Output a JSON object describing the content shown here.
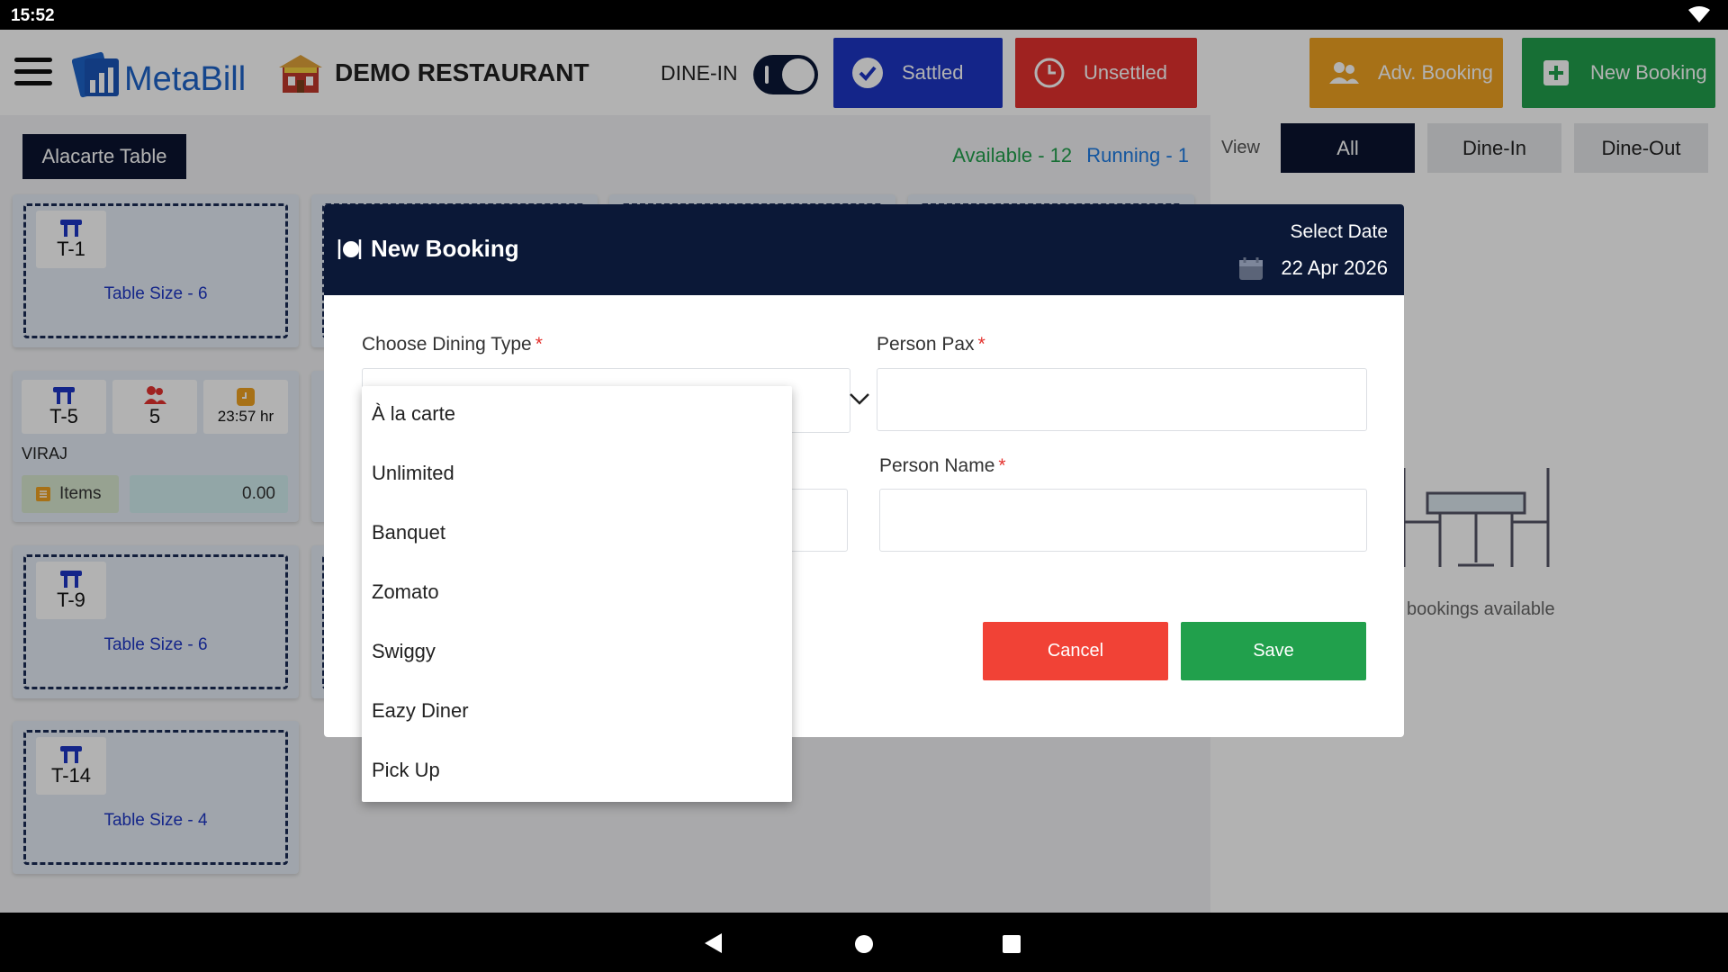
{
  "status_bar": {
    "time": "15:52",
    "wifi_icon": "wifi-icon"
  },
  "header": {
    "menu_icon": "hamburger-menu-icon",
    "app_name": "MetaBill",
    "restaurant_name": "DEMO RESTAURANT",
    "mode_label": "DINE-IN",
    "mode_toggle_on": true,
    "buttons": {
      "sattled": "Sattled",
      "unsettled": "Unsettled",
      "adv_booking": "Adv. Booking",
      "new_booking": "New Booking"
    },
    "colors": {
      "sattled": "#1d36c4",
      "unsettled": "#e4322e",
      "adv_booking": "#f0a322",
      "new_booking": "#21a04c"
    }
  },
  "tables_section": {
    "label": "Alacarte Table",
    "available": "Available - 12",
    "running": "Running - 1",
    "tables": [
      {
        "id": "T-1",
        "size": "Table Size - 6"
      },
      {
        "id": "T-5",
        "guests": "5",
        "time": "23:57 hr",
        "customer": "VIRAJ",
        "items_label": "Items",
        "amount": "0.00"
      },
      {
        "id": "T-9",
        "size": "Table Size - 6"
      },
      {
        "id": "T-14",
        "size": "Table Size - 4"
      }
    ]
  },
  "booking_panel": {
    "view_label": "View",
    "filters": [
      "All",
      "Dine-In",
      "Dine-Out"
    ],
    "active_filter": "All",
    "empty_text": "bookings available"
  },
  "modal": {
    "title": "New Booking",
    "select_date_label": "Select Date",
    "date": "22 Apr 2026",
    "fields": {
      "dining_type": {
        "label": "Choose Dining Type",
        "required": "*",
        "value": ""
      },
      "person_pax": {
        "label": "Person Pax",
        "required": "*",
        "value": ""
      },
      "person_name": {
        "label": "Person Name",
        "required": "*",
        "value": ""
      }
    },
    "cancel": "Cancel",
    "save": "Save"
  },
  "dropdown": {
    "options": [
      "À la carte",
      "Unlimited",
      "Banquet",
      "Zomato",
      "Swiggy",
      "Eazy Diner",
      "Pick Up"
    ]
  },
  "nav_bar": {
    "back": "back-icon",
    "home": "home-icon",
    "recents": "recents-icon"
  }
}
